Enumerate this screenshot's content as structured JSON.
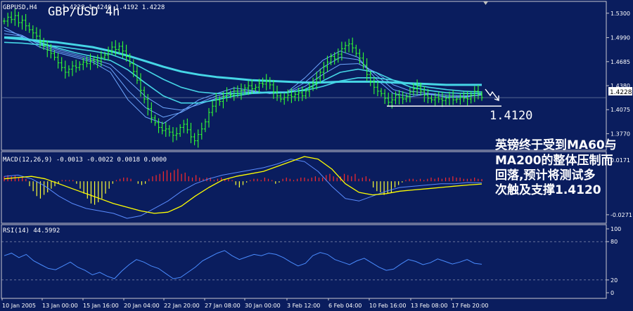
{
  "colors": {
    "background": "#0a1d5e",
    "frame": "#c8c8d0",
    "price_axis_text": "#ffffff",
    "candles": "#33ff33",
    "ma_fast": "#6ea8ff",
    "ma_slow": "#46d6e6",
    "macd_pos": "#ff2a2a",
    "macd_neg": "#ffff33",
    "macd_signal": "#ffff00",
    "macd_line": "#5a8cff",
    "rsi": "#4a8cff",
    "annotation": "#ffffff",
    "marker": "#c0c0c0",
    "last_price_box": "#ffffff"
  },
  "chart_data": [
    {
      "type": "candlestick",
      "panel": "price",
      "symbol_label": "GBPUSD,H4",
      "ohlc_text": "1.4228  1.4240  1.4192  1.4228",
      "title": "GBP/USD 4h",
      "y_axis_ticks": [
        "1.5300",
        "1.4990",
        "1.4685",
        "1.4380",
        "1.4075",
        "1.3770"
      ],
      "y_axis_values": [
        1.53,
        1.499,
        1.4685,
        1.438,
        1.4075,
        1.377
      ],
      "ylim": [
        1.356,
        1.545
      ],
      "last_price_label": "1.4228",
      "last_price": 1.4228,
      "support_label": "1.4120",
      "support_level": 1.412,
      "close_series": [
        1.52,
        1.525,
        1.522,
        1.527,
        1.518,
        1.521,
        1.514,
        1.509,
        1.505,
        1.501,
        1.494,
        1.489,
        1.483,
        1.479,
        1.474,
        1.467,
        1.461,
        1.455,
        1.459,
        1.463,
        1.461,
        1.465,
        1.468,
        1.466,
        1.47,
        1.471,
        1.469,
        1.474,
        1.477,
        1.482,
        1.487,
        1.484,
        1.488,
        1.482,
        1.475,
        1.466,
        1.456,
        1.445,
        1.432,
        1.421,
        1.409,
        1.397,
        1.391,
        1.385,
        1.381,
        1.383,
        1.379,
        1.375,
        1.377,
        1.385,
        1.389,
        1.382,
        1.373,
        1.368,
        1.376,
        1.383,
        1.392,
        1.404,
        1.412,
        1.42,
        1.418,
        1.424,
        1.428,
        1.426,
        1.431,
        1.428,
        1.432,
        1.435,
        1.438,
        1.434,
        1.436,
        1.441,
        1.44,
        1.444,
        1.439,
        1.43,
        1.425,
        1.421,
        1.423,
        1.426,
        1.424,
        1.427,
        1.429,
        1.425,
        1.431,
        1.436,
        1.441,
        1.447,
        1.455,
        1.462,
        1.468,
        1.475,
        1.472,
        1.478,
        1.485,
        1.489,
        1.491,
        1.486,
        1.479,
        1.473,
        1.464,
        1.452,
        1.443,
        1.436,
        1.431,
        1.428,
        1.422,
        1.417,
        1.42,
        1.426,
        1.423,
        1.421,
        1.424,
        1.43,
        1.434,
        1.437,
        1.431,
        1.426,
        1.422,
        1.42,
        1.423,
        1.421,
        1.419,
        1.422,
        1.424,
        1.42,
        1.421,
        1.423,
        1.422,
        1.421,
        1.426,
        1.431,
        1.427,
        1.4228
      ],
      "ma_series": [
        {
          "style": "fast",
          "values": [
            1.512,
            1.5,
            1.487,
            1.48,
            1.474,
            1.468,
            1.455,
            1.42,
            1.398,
            1.39,
            1.405,
            1.42,
            1.428,
            1.435,
            1.432,
            1.428,
            1.43,
            1.448,
            1.47,
            1.482,
            1.474,
            1.447,
            1.428,
            1.424,
            1.428,
            1.423,
            1.423,
            1.427
          ]
        },
        {
          "style": "fast",
          "values": [
            1.508,
            1.502,
            1.49,
            1.482,
            1.476,
            1.47,
            1.46,
            1.432,
            1.41,
            1.398,
            1.404,
            1.416,
            1.425,
            1.431,
            1.431,
            1.428,
            1.429,
            1.442,
            1.461,
            1.474,
            1.471,
            1.452,
            1.433,
            1.427,
            1.427,
            1.424,
            1.424,
            1.426
          ]
        },
        {
          "style": "fast",
          "values": [
            1.504,
            1.501,
            1.492,
            1.484,
            1.478,
            1.472,
            1.465,
            1.445,
            1.424,
            1.41,
            1.407,
            1.414,
            1.422,
            1.428,
            1.43,
            1.429,
            1.429,
            1.437,
            1.452,
            1.465,
            1.466,
            1.455,
            1.439,
            1.431,
            1.428,
            1.426,
            1.425,
            1.426
          ]
        },
        {
          "style": "slow",
          "values": [
            1.5,
            1.499,
            1.493,
            1.486,
            1.48,
            1.475,
            1.47,
            1.458,
            1.441,
            1.425,
            1.416,
            1.416,
            1.42,
            1.425,
            1.428,
            1.429,
            1.429,
            1.433,
            1.444,
            1.455,
            1.459,
            1.455,
            1.445,
            1.436,
            1.432,
            1.429,
            1.428,
            1.428
          ]
        },
        {
          "style": "slow",
          "values": [
            1.493,
            1.492,
            1.49,
            1.488,
            1.485,
            1.482,
            1.478,
            1.47,
            1.458,
            1.446,
            1.436,
            1.43,
            1.428,
            1.428,
            1.429,
            1.43,
            1.43,
            1.432,
            1.437,
            1.444,
            1.448,
            1.448,
            1.445,
            1.44,
            1.436,
            1.433,
            1.431,
            1.43
          ]
        },
        {
          "style": "slow",
          "values": [
            1.499,
            1.497,
            1.495,
            1.493,
            1.49,
            1.487,
            1.482,
            1.476,
            1.469,
            1.462,
            1.456,
            1.452,
            1.449,
            1.447,
            1.445,
            1.444,
            1.443,
            1.442,
            1.442,
            1.443,
            1.443,
            1.443,
            1.442,
            1.441,
            1.44,
            1.439,
            1.439,
            1.439
          ]
        }
      ]
    },
    {
      "type": "bar",
      "panel": "macd",
      "label": "MACD(12,26,9) -0.0013 -0.0022 0.0018 0.0000",
      "y_axis_ticks": [
        "0.0171",
        "-0.0271"
      ],
      "y_axis_values": [
        0.0171,
        -0.0271
      ],
      "ylim": [
        -0.034,
        0.024
      ],
      "histogram": [
        0.004,
        0.005,
        0.004,
        0.005,
        0.003,
        0.004,
        0.002,
        -0.004,
        -0.008,
        -0.012,
        -0.014,
        -0.011,
        -0.009,
        -0.006,
        -0.004,
        -0.002,
        0.001,
        0.001,
        0.001,
        0.001,
        -0.002,
        -0.006,
        -0.01,
        -0.014,
        -0.018,
        -0.019,
        -0.017,
        -0.014,
        -0.01,
        -0.006,
        -0.002,
        0.001,
        0.002,
        0.003,
        0.003,
        0.002,
        0.0,
        -0.002,
        -0.003,
        -0.002,
        0.002,
        0.004,
        0.005,
        0.006,
        0.008,
        0.009,
        0.007,
        0.009,
        0.01,
        0.006,
        0.007,
        0.004,
        0.003,
        0.005,
        0.003,
        0.002,
        0.003,
        0.003,
        0.001,
        0.002,
        0.003,
        0.002,
        0.002,
        0.001,
        -0.003,
        -0.005,
        -0.003,
        -0.001,
        0.001,
        0.002,
        0.002,
        0.001,
        0.003,
        0.002,
        0.001,
        -0.002,
        -0.001,
        0.002,
        0.003,
        0.002,
        0.001,
        0.002,
        0.003,
        0.003,
        0.002,
        0.003,
        0.004,
        0.003,
        0.003,
        0.005,
        0.006,
        0.004,
        0.003,
        0.004,
        0.006,
        0.005,
        0.004,
        0.006,
        0.002,
        0.003,
        0.004,
        0.002,
        -0.005,
        -0.008,
        -0.009,
        -0.011,
        -0.01,
        -0.009,
        -0.005,
        -0.003,
        -0.001,
        0.001,
        0.002,
        0.002,
        0.001,
        0.002,
        0.001,
        0.002,
        0.003,
        0.002,
        0.003,
        0.002,
        0.003,
        0.003,
        0.004,
        0.003,
        0.003,
        0.002,
        0.002,
        0.002,
        0.003,
        0.002,
        0.0018
      ],
      "signal": [
        0.002,
        0.003,
        0.004,
        0.002,
        -0.002,
        -0.006,
        -0.01,
        -0.014,
        -0.018,
        -0.021,
        -0.024,
        -0.026,
        -0.025,
        -0.02,
        -0.012,
        -0.005,
        0.001,
        0.004,
        0.006,
        0.008,
        0.012,
        0.016,
        0.02,
        0.018,
        0.01,
        -0.002,
        -0.009,
        -0.011,
        -0.01,
        -0.008,
        -0.007,
        -0.006,
        -0.005,
        -0.004,
        -0.003,
        -0.0022
      ],
      "macd_line": [
        0.004,
        0.005,
        0.002,
        -0.004,
        -0.012,
        -0.018,
        -0.022,
        -0.024,
        -0.026,
        -0.03,
        -0.028,
        -0.022,
        -0.016,
        -0.008,
        -0.002,
        0.002,
        0.005,
        0.007,
        0.009,
        0.011,
        0.014,
        0.018,
        0.016,
        0.008,
        -0.004,
        -0.014,
        -0.016,
        -0.012,
        -0.008,
        -0.005,
        -0.004,
        -0.003,
        -0.002,
        -0.002,
        -0.001,
        -0.0013
      ]
    },
    {
      "type": "line",
      "panel": "rsi",
      "label": "RSI(14) 44.5992",
      "y_axis_ticks": [
        "100",
        "80",
        "20",
        "0"
      ],
      "y_axis_values": [
        100,
        80,
        20,
        0
      ],
      "ylim": [
        0,
        100
      ],
      "values": [
        58,
        62,
        55,
        60,
        50,
        44,
        38,
        36,
        42,
        48,
        40,
        35,
        28,
        32,
        26,
        22,
        34,
        44,
        52,
        48,
        42,
        38,
        30,
        22,
        24,
        32,
        40,
        50,
        56,
        62,
        66,
        58,
        52,
        56,
        60,
        58,
        62,
        60,
        55,
        48,
        42,
        46,
        58,
        63,
        60,
        52,
        48,
        44,
        50,
        54,
        47,
        40,
        35,
        37,
        45,
        52,
        49,
        44,
        47,
        53,
        49,
        45,
        48,
        52,
        46,
        44.6
      ],
      "x_tick_labels": [
        "10 Jan 2005",
        "13 Jan 00:00",
        "15 Jan 16:00",
        "20 Jan 04:00",
        "22 Jan 20:00",
        "27 Jan 08:00",
        "30 Jan 00:00",
        "3 Feb 12:00",
        "6 Feb 04:00",
        "10 Feb 16:00",
        "13 Feb 08:00",
        "17 Feb 20:00"
      ]
    }
  ],
  "annotation_lines": [
    "英镑终于受到MA60与",
    "MA200的整体压制而",
    "回落,预计将测试多",
    "次触及支撑1.4120"
  ]
}
